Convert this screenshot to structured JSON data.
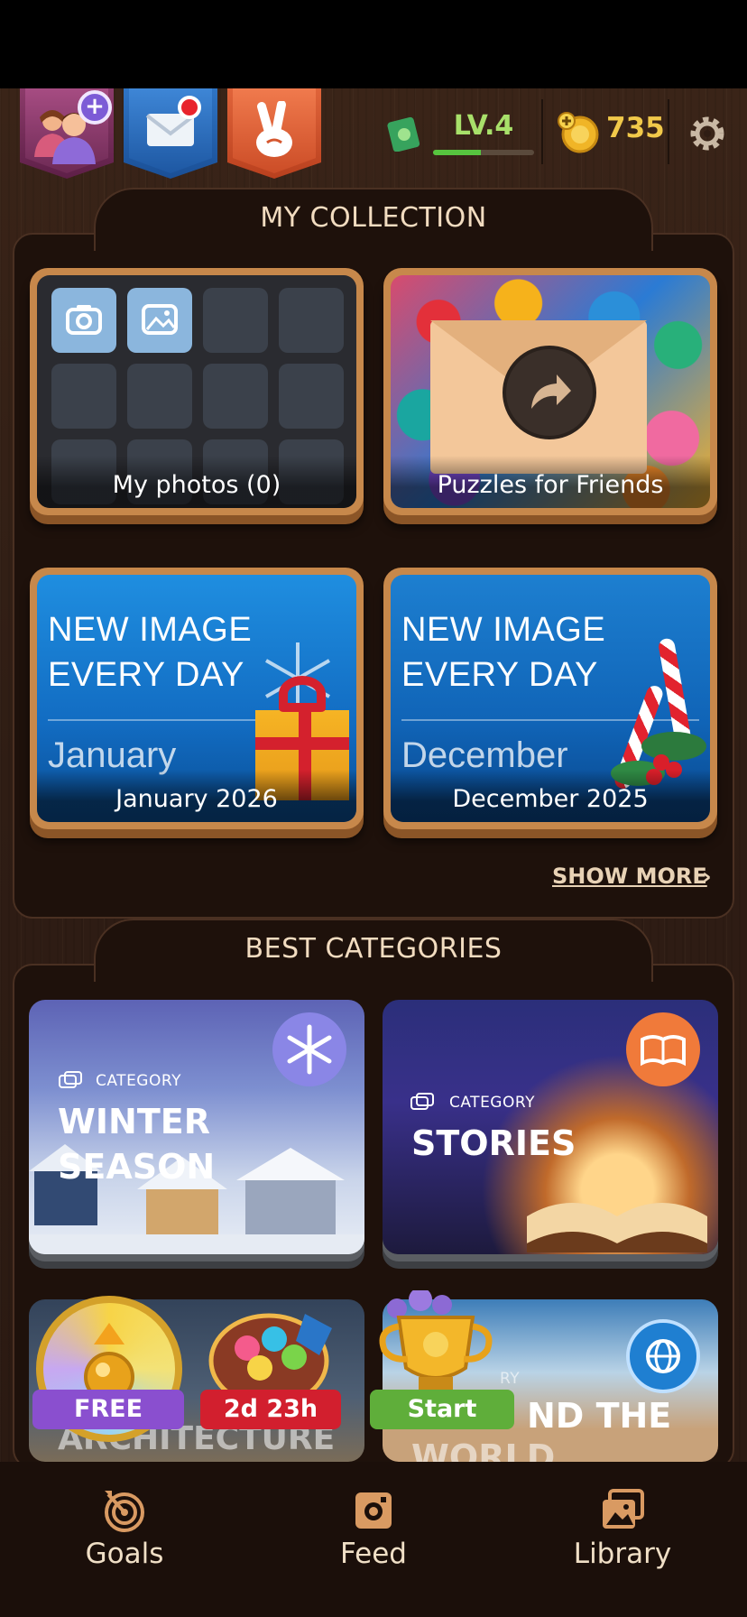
{
  "header": {
    "level": "LV.4",
    "level_progress": 0.47,
    "coins": "735"
  },
  "my_collection": {
    "title": "MY COLLECTION",
    "tiles": [
      {
        "label": "My photos (0)"
      },
      {
        "label": "Puzzles for Friends"
      },
      {
        "label": "January 2026",
        "art_title_1": "NEW IMAGE",
        "art_title_2": "EVERY DAY",
        "art_month": "January"
      },
      {
        "label": "December 2025",
        "art_title_1": "NEW IMAGE",
        "art_title_2": "EVERY DAY",
        "art_month": "December"
      }
    ],
    "show_more": "SHOW MORE"
  },
  "best_categories": {
    "title": "BEST CATEGORIES",
    "cards": [
      {
        "kicker": "CATEGORY",
        "title_1": "WINTER",
        "title_2": "SEASON"
      },
      {
        "kicker": "CATEGORY",
        "title_1": "STORIES"
      }
    ],
    "row3": {
      "arch_partial": "ARCHITECTURE",
      "world_partial": "ND THE",
      "world_partial_2": "WORLD",
      "kicker_partial": "RY"
    }
  },
  "events": {
    "free_label": "FREE",
    "timer_label": "2d 23h",
    "start_label": "Start"
  },
  "bottom_nav": [
    {
      "label": "Goals",
      "icon": "target-icon"
    },
    {
      "label": "Feed",
      "icon": "instagram-icon"
    },
    {
      "label": "Library",
      "icon": "gallery-icon"
    }
  ],
  "colors": {
    "level_text": "#a8e06a",
    "coin_text": "#f1c94a",
    "wood_frame": "#c7884b"
  }
}
